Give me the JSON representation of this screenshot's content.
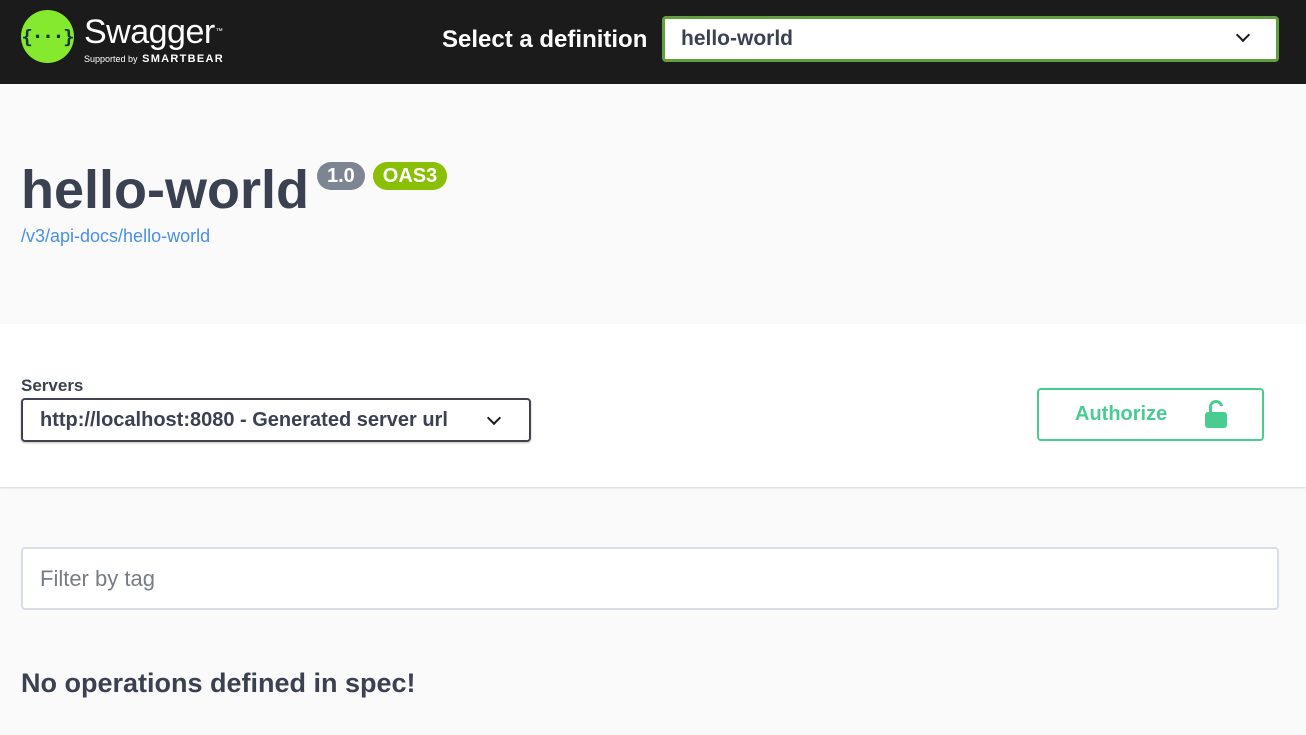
{
  "topbar": {
    "logo": {
      "icon": "swagger-braces-icon",
      "icon_glyph": "{···}",
      "name": "Swagger",
      "tm": "™",
      "supported_by": "Supported by",
      "brand": "SMARTBEAR",
      "accent_color": "#85ea2d"
    },
    "definition_label": "Select a definition",
    "definition_selected": "hello-world",
    "definition_border_color": "#62a03f"
  },
  "info": {
    "title": "hello-world",
    "version": "1.0",
    "oas_badge": "OAS3",
    "spec_url": "/v3/api-docs/hello-world"
  },
  "servers": {
    "label": "Servers",
    "selected": "http://localhost:8080 - Generated server url"
  },
  "authorize": {
    "label": "Authorize",
    "icon": "unlocked-lock-icon",
    "color": "#49cc90"
  },
  "filter": {
    "placeholder": "Filter by tag",
    "value": ""
  },
  "operations": {
    "empty_message": "No operations defined in spec!"
  }
}
